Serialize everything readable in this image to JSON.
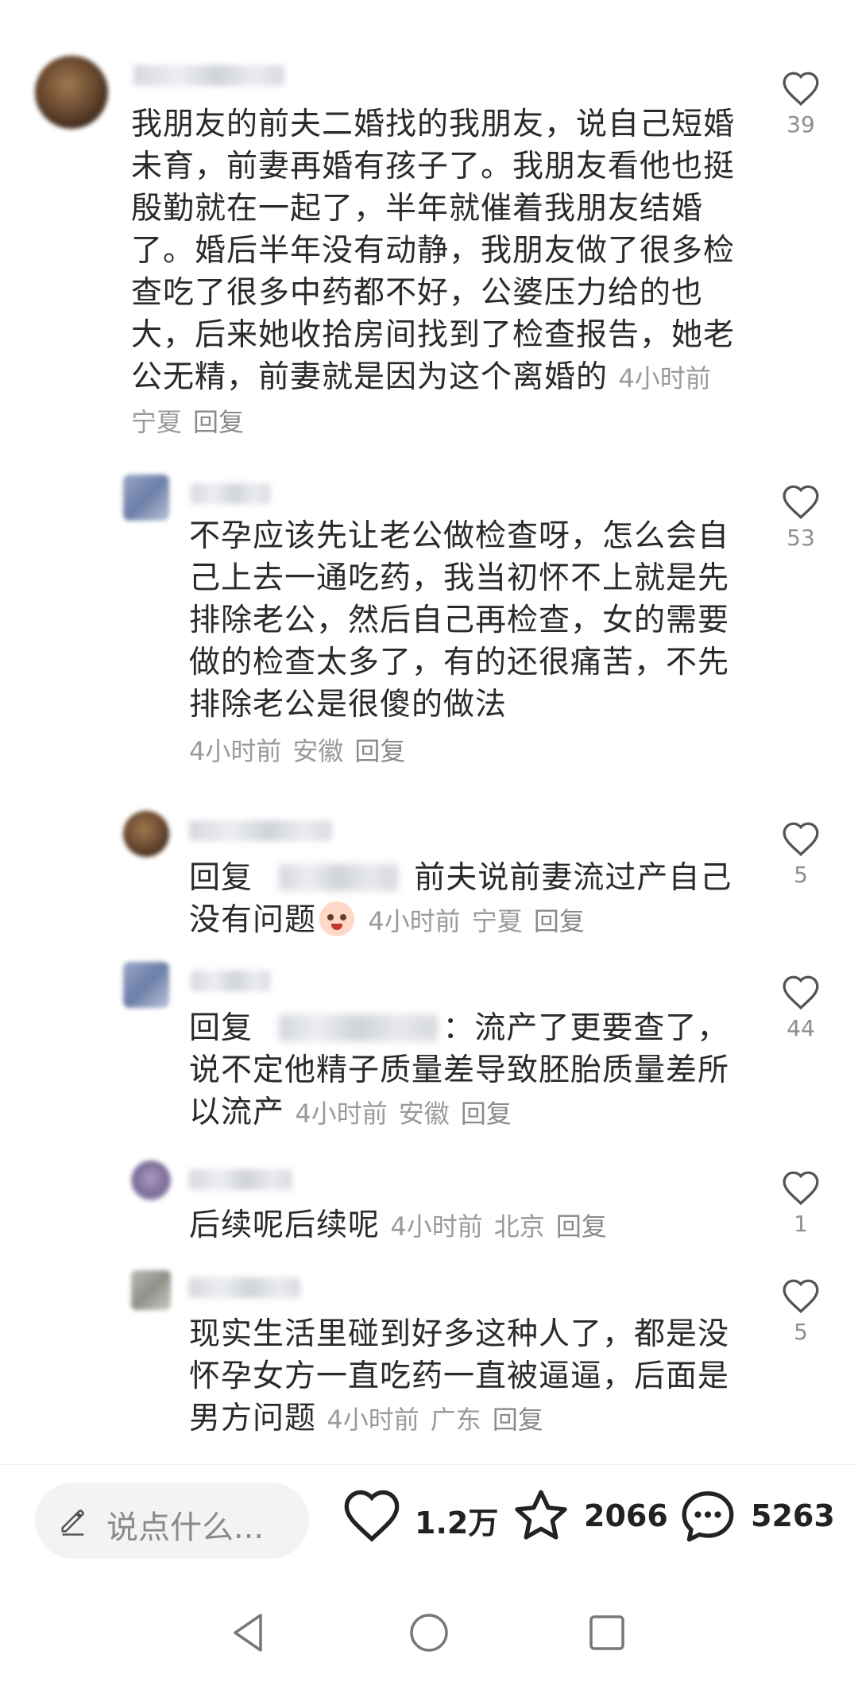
{
  "comments": [
    {
      "text": "我朋友的前夫二婚找的我朋友，说自己短婚未育，前妻再婚有孩子了。我朋友看他也挺殷勤就在一起了，半年就催着我朋友结婚了。婚后半年没有动静，我朋友做了很多检查吃了很多中药都不好，公婆压力给的也大，后来她收拾房间找到了检查报告，她老公无精，前妻就是因为这个离婚",
      "text_tail": "的",
      "time": "4小时前",
      "location": "宁夏",
      "reply_label": "回复",
      "likes": "39"
    },
    {
      "text": "不孕应该先让老公做检查呀，怎么会自己上去一通吃药，我当初怀不上就是先排除老公，然后自己再检查，女的需要做的检查太多了，有的还很痛苦，不先排除老公是很傻的做法",
      "time": "4小时前",
      "location": "安徽",
      "reply_label": "回复",
      "likes": "53"
    },
    {
      "prefix": "回复",
      "text_line1": "前夫说前妻流过产自己",
      "text_line2": "没有问题",
      "time": "4小时前",
      "location": "宁夏",
      "reply_label": "回复",
      "likes": "5"
    },
    {
      "prefix": "回复",
      "text_line1": "：流产了更要查了，",
      "text_line2": "说不定他精子质量差导致胚胎质量差所",
      "text_line3": "以流产",
      "time": "4小时前",
      "location": "安徽",
      "reply_label": "回复",
      "likes": "44"
    },
    {
      "text": "后续呢后续呢",
      "time": "4小时前",
      "location": "北京",
      "reply_label": "回复",
      "likes": "1"
    },
    {
      "text_line1": "现实生活里碰到好多这种人了，都是没",
      "text_line2": "怀孕女方一直吃药一直被逼逼，后面是",
      "text_line3": "男方问题",
      "time": "4小时前",
      "location": "广东",
      "reply_label": "回复",
      "likes": "5"
    }
  ],
  "bottom_bar": {
    "input_placeholder": "说点什么...",
    "likes_total": "1.2万",
    "favorites_total": "2066",
    "comments_total": "5263"
  },
  "icons": {
    "like": "heart-icon",
    "favorite": "star-icon",
    "comment": "chat-bubble-icon",
    "input": "pencil-icon",
    "nav_back": "triangle-back-icon",
    "nav_home": "circle-home-icon",
    "nav_recents": "square-recents-icon"
  }
}
